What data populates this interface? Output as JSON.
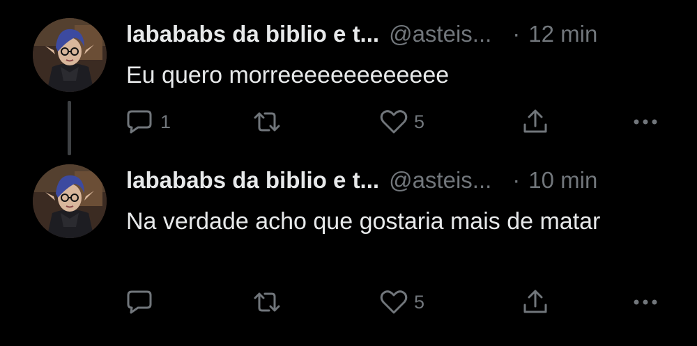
{
  "colors": {
    "background": "#000000",
    "text_primary": "#e7e9ea",
    "text_secondary": "#71767b",
    "thread_line": "#3e4144"
  },
  "tweets": [
    {
      "display_name": "labababs da biblio e t...",
      "handle": "@asteis...",
      "separator": "·",
      "time": "12 min",
      "text": "Eu quero morreeeeeeeeeeeee",
      "reply_count": "1",
      "retweet_count": "",
      "like_count": "5",
      "avatar": "avatar-portrait-icon"
    },
    {
      "display_name": "labababs da biblio e t...",
      "handle": "@asteis...",
      "separator": "·",
      "time": "10 min",
      "text": "Na verdade acho que gostaria mais de matar",
      "reply_count": "",
      "retweet_count": "",
      "like_count": "5",
      "avatar": "avatar-portrait-icon"
    }
  ]
}
